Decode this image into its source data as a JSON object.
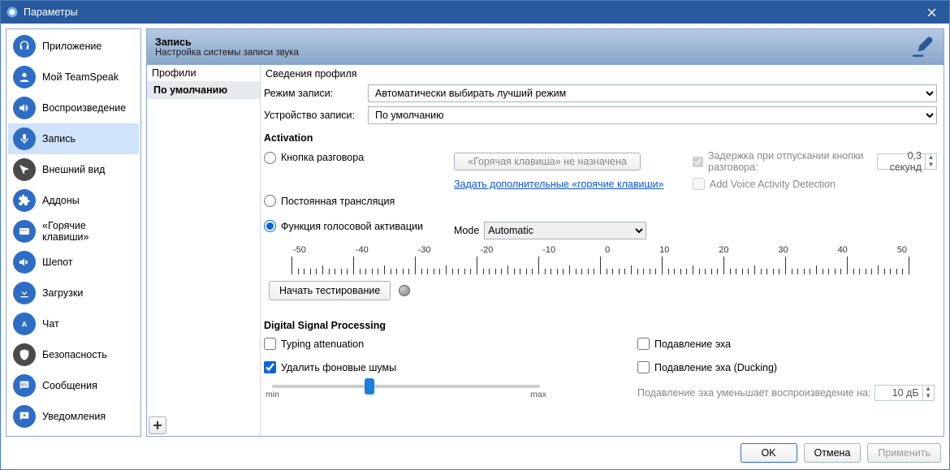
{
  "window": {
    "title": "Параметры"
  },
  "sidebar": {
    "items": [
      {
        "label": "Приложение"
      },
      {
        "label": "Мой TeamSpeak"
      },
      {
        "label": "Воспроизведение"
      },
      {
        "label": "Запись"
      },
      {
        "label": "Внешний вид"
      },
      {
        "label": "Аддоны"
      },
      {
        "label": "«Горячие клавиши»"
      },
      {
        "label": "Шепот"
      },
      {
        "label": "Загрузки"
      },
      {
        "label": "Чат"
      },
      {
        "label": "Безопасность"
      },
      {
        "label": "Сообщения"
      },
      {
        "label": "Уведомления"
      }
    ]
  },
  "page": {
    "title": "Запись",
    "subtitle": "Настройка системы записи звука"
  },
  "profiles": {
    "heading": "Профили",
    "default_item": "По умолчанию"
  },
  "details": {
    "heading": "Сведения профиля",
    "capture_mode_label": "Режим записи:",
    "capture_mode_value": "Автоматически выбирать лучший режим",
    "capture_device_label": "Устройство записи:",
    "capture_device_value": "По умолчанию"
  },
  "activation": {
    "heading": "Activation",
    "ptt_label": "Кнопка разговора",
    "hotkey_unset": "«Горячая клавиша» не назначена",
    "more_hotkeys_link": "Задать дополнительные «горячие клавиши»",
    "delay_label": "Задержка при отпускании кнопки разговора:",
    "delay_value": "0,3 секунд",
    "add_vad_label": "Add Voice Activity Detection",
    "ct_label": "Постоянная трансляция",
    "vad_label": "Функция голосовой активации",
    "mode_label": "Mode",
    "mode_value": "Automatic",
    "ticks": [
      "-50",
      "-40",
      "-30",
      "-20",
      "-10",
      "0",
      "10",
      "20",
      "30",
      "40",
      "50"
    ],
    "test_label": "Начать тестирование"
  },
  "dsp": {
    "heading": "Digital Signal Processing",
    "typing_att": "Typing attenuation",
    "echo_cancel": "Подавление эха",
    "remove_noise": "Удалить фоновые шумы",
    "echo_ducking": "Подавление эха (Ducking)",
    "min": "min",
    "max": "max",
    "reduce_label": "Подавление эха уменьшает воспроизведение на:",
    "reduce_value": "10 дБ"
  },
  "buttons": {
    "ok": "OK",
    "cancel": "Отмена",
    "apply": "Применить"
  }
}
